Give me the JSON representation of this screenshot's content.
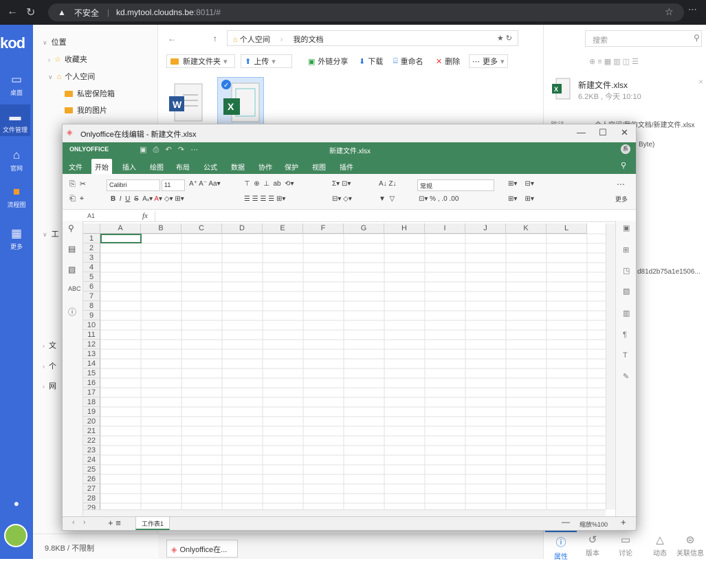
{
  "browser": {
    "security": "不安全",
    "host": "kd.mytool.cloudns.be",
    "path": ":8011/#"
  },
  "kod": {
    "logo": "kod",
    "nav": [
      {
        "label": "桌面",
        "icon": "desktop-icon"
      },
      {
        "label": "文件管理",
        "icon": "folder-icon"
      },
      {
        "label": "官网",
        "icon": "home-icon"
      },
      {
        "label": "流程图",
        "icon": "flowchart-icon"
      },
      {
        "label": "更多",
        "icon": "grid-icon"
      }
    ]
  },
  "tree": {
    "location": "位置",
    "favorites": "收藏夹",
    "personal": "个人空间",
    "items": [
      "私密保险箱",
      "我的图片"
    ],
    "partial": [
      "工",
      "文",
      "个",
      "网"
    ]
  },
  "main": {
    "breadcrumb": [
      "个人空间",
      "我的文档"
    ],
    "toolbar": [
      "新建文件夹",
      "上传",
      "外链分享",
      "下载",
      "重命名",
      "删除",
      "更多"
    ]
  },
  "right": {
    "search_placeholder": "搜索",
    "filename": "新建文件.xlsx",
    "meta": "6.2KB , 今天 10:10",
    "path_label": "路径",
    "path_value": "个人空间/我的文档/新建文件.xlsx",
    "size_note": "Byte)",
    "hash": "d81d2b75a1e1506...",
    "tabs": [
      "属性",
      "版本",
      "讨论",
      "动态",
      "关联信息"
    ]
  },
  "status": {
    "quota": "9.8KB / 不限制",
    "task": "Onlyoffice在..."
  },
  "dialog": {
    "title": "Onlyoffice在线编辑 - 新建文件.xlsx",
    "brand": "ONLYOFFICE",
    "doc_title": "新建文件.xlsx",
    "user_initial": "系",
    "tabs": [
      "文件",
      "开始",
      "插入",
      "绘图",
      "布局",
      "公式",
      "数据",
      "协作",
      "保护",
      "视图",
      "插件"
    ],
    "active_tab": "开始",
    "font": "Calibri",
    "font_size": "11",
    "number_format": "常规",
    "more_label": "更多",
    "cell_ref": "A1",
    "fx": "fx",
    "columns": [
      "A",
      "B",
      "C",
      "D",
      "E",
      "F",
      "G",
      "H",
      "I",
      "J",
      "K",
      "L"
    ],
    "rows": [
      "1",
      "2",
      "3",
      "4",
      "5",
      "6",
      "7",
      "8",
      "9",
      "10",
      "11",
      "12",
      "13",
      "14",
      "15",
      "16",
      "17",
      "18",
      "19",
      "20",
      "21",
      "22",
      "23",
      "24",
      "25",
      "26",
      "27",
      "28",
      "29"
    ],
    "sheet": "工作表1",
    "zoom": "缩放%100"
  }
}
